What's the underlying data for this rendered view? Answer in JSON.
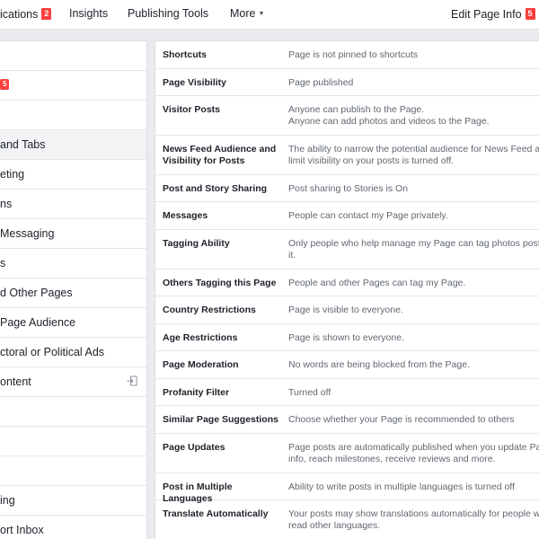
{
  "nav": {
    "notifications_label": "ications",
    "notifications_badge": "2",
    "insights_label": "Insights",
    "publishing_tools_label": "Publishing Tools",
    "more_label": "More",
    "edit_page_info_label": "Edit Page Info",
    "edit_page_info_badge": "5"
  },
  "sidebar": {
    "items": [
      {
        "label": ""
      },
      {
        "label": "",
        "badge": "5"
      },
      {
        "label": ""
      },
      {
        "label": " and Tabs"
      },
      {
        "label": "eting"
      },
      {
        "label": "ns"
      },
      {
        "label": " Messaging"
      },
      {
        "label": "s"
      },
      {
        "label": "d Other Pages"
      },
      {
        "label": "Page Audience"
      },
      {
        "label": "ctoral or Political Ads"
      },
      {
        "label": "ontent"
      },
      {
        "label": ""
      },
      {
        "label": ""
      },
      {
        "label": ""
      },
      {
        "label": "ing"
      },
      {
        "label": "ort Inbox"
      }
    ]
  },
  "settings": [
    {
      "label": "Shortcuts",
      "value": [
        "Page is not pinned to shortcuts"
      ]
    },
    {
      "label": "Page Visibility",
      "value": [
        "Page published"
      ]
    },
    {
      "label": "Visitor Posts",
      "value": [
        "Anyone can publish to the Page.",
        "Anyone can add photos and videos to the Page."
      ]
    },
    {
      "label": "News Feed Audience and Visibility for Posts",
      "value": [
        "The ability to narrow the potential audience for News Feed a",
        "limit visibility on your posts is turned off."
      ]
    },
    {
      "label": "Post and Story Sharing",
      "value": [
        "Post sharing to Stories is On"
      ]
    },
    {
      "label": "Messages",
      "value": [
        "People can contact my Page privately."
      ]
    },
    {
      "label": "Tagging Ability",
      "value": [
        "Only people who help manage my Page can tag photos post",
        "it."
      ]
    },
    {
      "label": "Others Tagging this Page",
      "value": [
        "People and other Pages can tag my Page."
      ]
    },
    {
      "label": "Country Restrictions",
      "value": [
        "Page is visible to everyone."
      ]
    },
    {
      "label": "Age Restrictions",
      "value": [
        "Page is shown to everyone."
      ]
    },
    {
      "label": "Page Moderation",
      "value": [
        "No words are being blocked from the Page."
      ]
    },
    {
      "label": "Profanity Filter",
      "value": [
        "Turned off"
      ]
    },
    {
      "label": "Similar Page Suggestions",
      "value": [
        "Choose whether your Page is recommended to others"
      ]
    },
    {
      "label": "Page Updates",
      "value": [
        "Page posts are automatically published when you update Pa",
        "info, reach milestones, receive reviews and more."
      ]
    },
    {
      "label": "Post in Multiple Languages",
      "value": [
        "Ability to write posts in multiple languages is turned off"
      ]
    },
    {
      "label": "Translate Automatically",
      "value": [
        "Your posts may show translations automatically for people w",
        "read other languages."
      ]
    }
  ]
}
